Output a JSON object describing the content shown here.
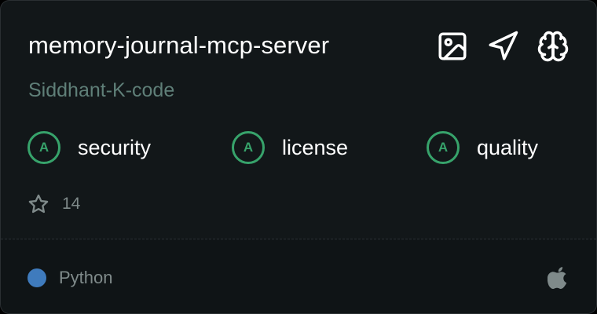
{
  "repo": {
    "name": "memory-journal-mcp-server",
    "owner": "Siddhant-K-code"
  },
  "actions": [
    {
      "name": "image-icon"
    },
    {
      "name": "send-icon"
    },
    {
      "name": "brain-icon"
    }
  ],
  "scores": [
    {
      "grade": "A",
      "label": "security"
    },
    {
      "grade": "A",
      "label": "license"
    },
    {
      "grade": "A",
      "label": "quality"
    }
  ],
  "stars": {
    "icon": "star-icon",
    "count": "14"
  },
  "language": {
    "name": "Python",
    "color": "#3f7bbd"
  },
  "platform": {
    "icon": "apple-icon"
  },
  "colors": {
    "grade_accent": "#37a36b",
    "owner_text": "#5f7f78",
    "muted_text": "#7f8a8a"
  }
}
